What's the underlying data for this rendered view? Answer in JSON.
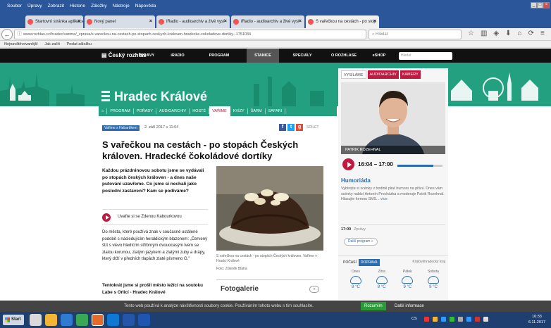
{
  "browser": {
    "menu": [
      "Soubor",
      "Úpravy",
      "Zobrazit",
      "Historie",
      "Záložky",
      "Nástroje",
      "Nápověda"
    ],
    "tabs": [
      {
        "label": "Startovní stránka aplikace Mozi",
        "active": false
      },
      {
        "label": "Nový panel",
        "active": false
      },
      {
        "label": "iRadio - audioarchiv a živé vysí",
        "active": false
      },
      {
        "label": "iRadio - audioarchiv a živé vysí",
        "active": false
      },
      {
        "label": "S vařečkou na cestách - po stop",
        "active": true
      }
    ],
    "new_tab": "+",
    "close_glyph": "×",
    "url": "www.rozhlas.cz/hradec/varime/_zprava/s-vareckou-na-cestach-po-stopach-ceskych-kraloven-hradecke-cokoladove-dortiky--1751034",
    "search_placeholder": "Hledat",
    "bookmarks": [
      "Nejnavštěvovanější",
      "Jak začít",
      "Poslat záložku"
    ]
  },
  "site": {
    "logo": "Český rozhlas",
    "nav": [
      "ZPRÁVY",
      "iRADIO",
      "PROGRAM",
      "STANICE",
      "SPECIÁLY",
      "O ROZHLASE",
      "eSHOP"
    ],
    "nav_active": "STANICE",
    "search_placeholder": "Hledat",
    "station": "Hradec Králové",
    "subnav": [
      "PROGRAM",
      "POŘADY",
      "AUDIOARCHIV",
      "HOSTÉ",
      "VAŘÍME",
      "KVÍZY",
      "ŠARM",
      "SAFARI"
    ],
    "subnav_active": "VAŘÍME"
  },
  "article": {
    "category": "Vaříme s Habartíkem",
    "date": "2. září 2017 v 11:04",
    "share_label": "SDÍLET",
    "title": "S vařečkou na cestách - po stopách Českých královen. Hradecké čokoládové dortíky",
    "perex": "Každou prázdninovou sobotu jsme se vydávali po stopách českých královen - a dnes naše putování uzavřeme. Co jsme si nechali jako poslední zastavení? Kam se podíváme?",
    "listen_label": "Uvařte si se Zdenou Kabourkovou",
    "body1": "Do města, které používá znak v současné ustálené podobě s následujícím heraldickým blazonem: „Červený štít s vlevo hledícím stříbrným dvouocasým lvem se zlatou korunou, zlatým jazykem a zlatými zuby a drápy, který drží v předních tlapách zlaté písmeno G.\"",
    "body2": "Tentokrát jsme si prošli město ležící na soutoku Labe s Orlicí - Hradec Králové",
    "caption": "S vařečkou na cestách - po stopách Českých královen. Vaříme v Hradci Králové",
    "photo_credit": "Foto: Zdeněk Bláha",
    "gallery_title": "Fotogalerie",
    "gallery_arrow": "»"
  },
  "sidebar": {
    "tabs": [
      "VYSÍLÁME",
      "AUDIOARCHIV",
      "KAMERY"
    ],
    "host_name": "PATRIK ROZEHNAL",
    "time": "16:04 – 17:00",
    "progress": 0.8,
    "show": "Humoriáda",
    "show_desc": "Vybírejte si scénky v hodině plné humoru na přání. Dnes vám scénky nabízí Antonín Procházka a moderuje Patrik Rozehnal. Hlasujte formou SMS...",
    "more": "více",
    "next_time": "17:00",
    "next_show": "Zprávy",
    "program_btn": "Další program »"
  },
  "weather": {
    "tabs": [
      "POČASÍ",
      "DOPRAVA"
    ],
    "active_tab": "DOPRAVA",
    "region": "Královéhradecký kraj",
    "days": [
      {
        "name": "Dnes",
        "temp": "8 °C"
      },
      {
        "name": "Zítra",
        "temp": "8 °C"
      },
      {
        "name": "Pátek",
        "temp": "9 °C"
      },
      {
        "name": "Sobota",
        "temp": "9 °C"
      }
    ]
  },
  "cookie": {
    "text": "Tento web používá k analýze návštěvnosti soubory cookie. Používáním tohoto webu s tím souhlasíte.",
    "accept": "Rozumím",
    "more": "Další informace"
  },
  "taskbar": {
    "start": "Start",
    "lang": "CS",
    "time": "16:33",
    "date": "6.11.2017"
  },
  "colors": {
    "brand_green": "#22a080",
    "brand_red": "#c0193f",
    "link_blue": "#2b6cb0",
    "chrome_blue": "#2b579a"
  }
}
